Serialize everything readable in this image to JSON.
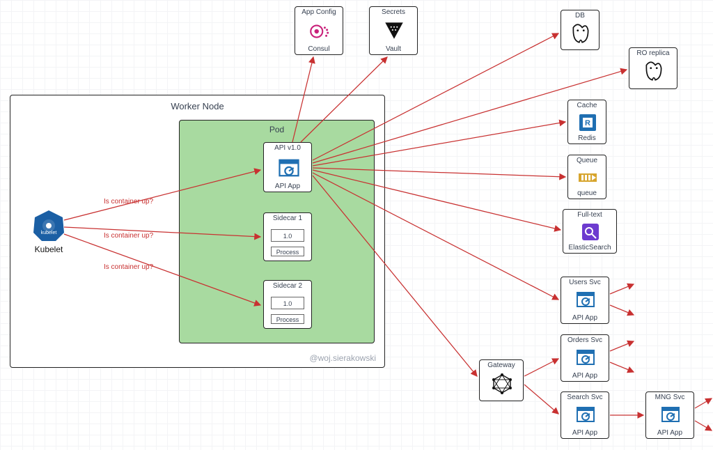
{
  "worker_node": {
    "title": "Worker Node"
  },
  "pod": {
    "title": "Pod"
  },
  "kubelet": {
    "label": "Kubelet",
    "icon": "kubelet"
  },
  "containers": {
    "api": {
      "title": "API v1.0",
      "sublabel": "API App"
    },
    "sidecar1": {
      "title": "Sidecar 1",
      "version": "1.0",
      "proc": "Process"
    },
    "sidecar2": {
      "title": "Sidecar 2",
      "version": "1.0",
      "proc": "Process"
    }
  },
  "top_services": {
    "app_config": {
      "title": "App Config",
      "sublabel": "Consul"
    },
    "secrets": {
      "title": "Secrets",
      "sublabel": "Vault"
    }
  },
  "right_services": {
    "db": {
      "title": "DB"
    },
    "ro_replica": {
      "title": "RO replica"
    },
    "cache": {
      "title": "Cache",
      "sublabel": "Redis"
    },
    "queue": {
      "title": "Queue",
      "sublabel": "queue"
    },
    "fulltext": {
      "title": "Full-text",
      "sublabel": "ElasticSearch"
    },
    "users": {
      "title": "Users Svc",
      "sublabel": "API App"
    },
    "orders": {
      "title": "Orders Svc",
      "sublabel": "API App"
    },
    "search": {
      "title": "Search Svc",
      "sublabel": "API App"
    },
    "mng": {
      "title": "MNG Svc",
      "sublabel": "API App"
    },
    "gateway": {
      "title": "Gateway"
    }
  },
  "edge_labels": {
    "q1": "Is container up?",
    "q2": "Is container up?",
    "q3": "Is container up?"
  },
  "watermark": "@woj.sierakowski"
}
